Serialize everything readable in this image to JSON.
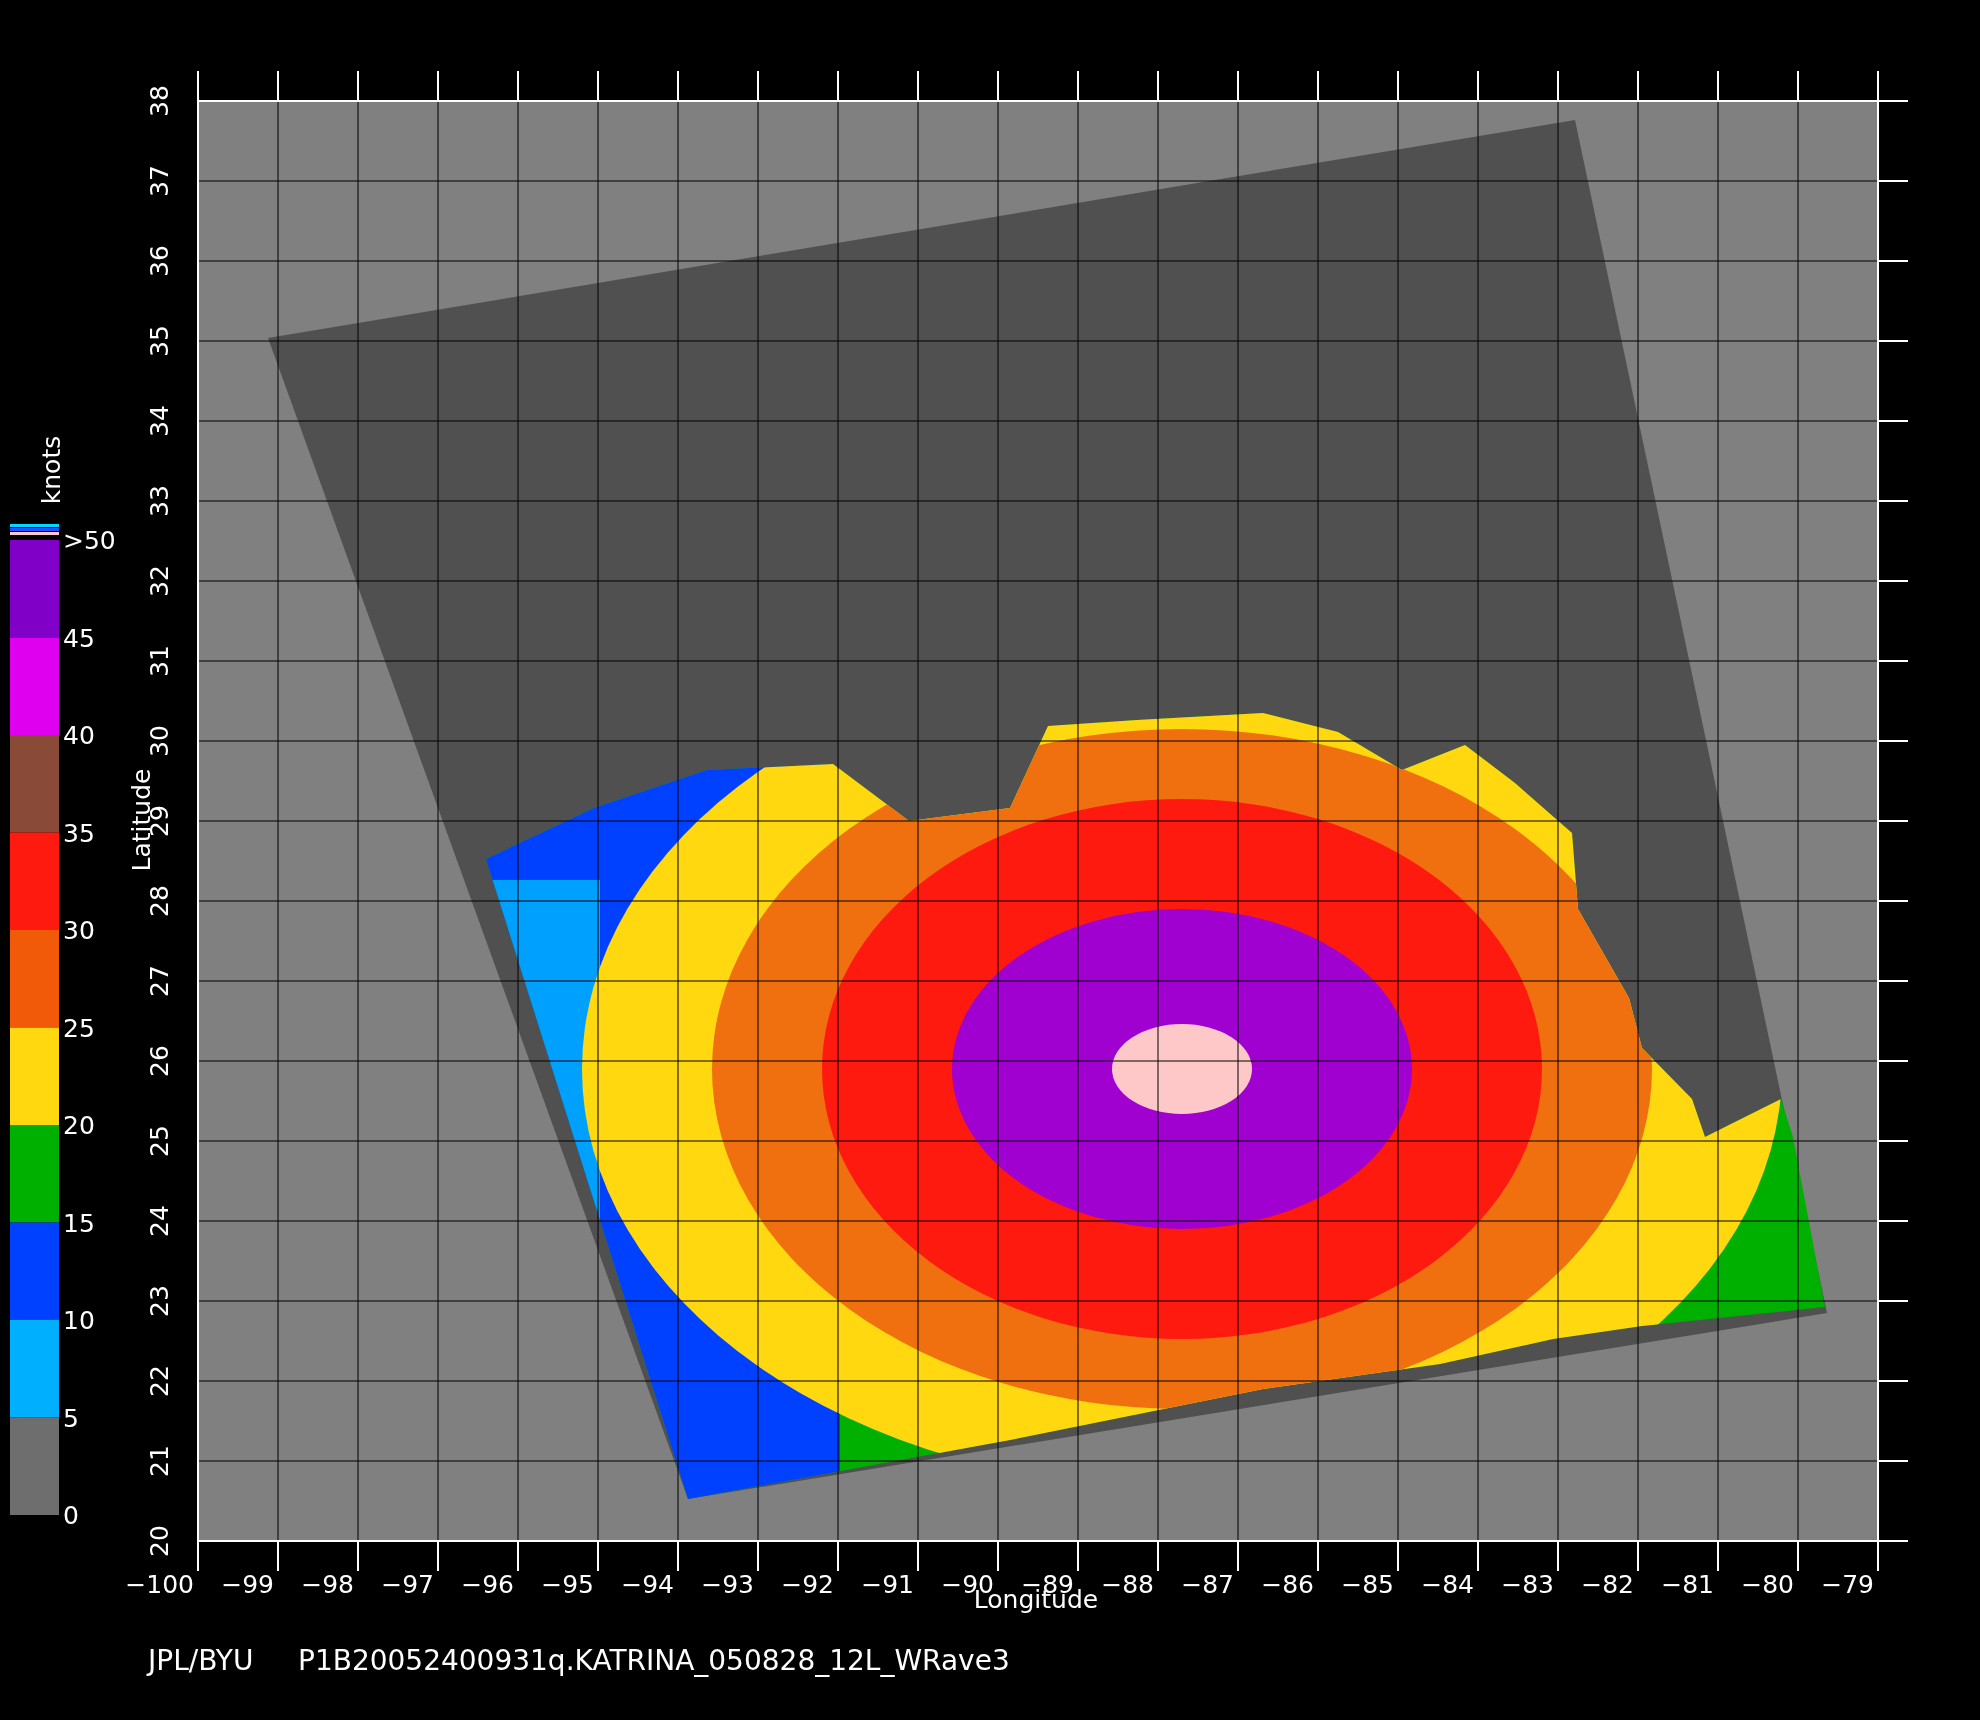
{
  "chart": {
    "xlabel": "Longitude",
    "ylabel": "Latitude",
    "xtick_labels": [
      "−100",
      "−99",
      "−98",
      "−97",
      "−96",
      "−95",
      "−94",
      "−93",
      "−92",
      "−91",
      "−90",
      "−89",
      "−88",
      "−87",
      "−86",
      "−85",
      "−84",
      "−83",
      "−82",
      "−81",
      "−80",
      "−79"
    ],
    "ytick_labels": [
      "38",
      "37",
      "36",
      "35",
      "34",
      "33",
      "32",
      "31",
      "30",
      "29",
      "28",
      "27",
      "26",
      "25",
      "24",
      "23",
      "22",
      "21",
      "20"
    ]
  },
  "colorbar": {
    "unit": "knots",
    "bands": [
      {
        "color": "#8000c8"
      },
      {
        "color": "#e000f0"
      },
      {
        "color": "#8a4a38"
      },
      {
        "color": "#ff1a10"
      },
      {
        "color": "#f05a08"
      },
      {
        "color": "#ffd810"
      },
      {
        "color": "#00b000"
      },
      {
        "color": "#0040ff"
      },
      {
        "color": "#00b0ff"
      },
      {
        "color": "#6e6e6e"
      }
    ],
    "top_stripes": [
      {
        "color": "#00d8ff"
      },
      {
        "color": "#2050ff"
      },
      {
        "color": "#ffc8c8"
      }
    ],
    "labels": [
      ">50",
      "45",
      "40",
      "35",
      "30",
      "25",
      "20",
      "15",
      "10",
      "5",
      "0"
    ]
  },
  "footer": {
    "source": "JPL/BYU",
    "file": "P1B20052400931q.KATRINA_050828_12L_WRave3"
  }
}
